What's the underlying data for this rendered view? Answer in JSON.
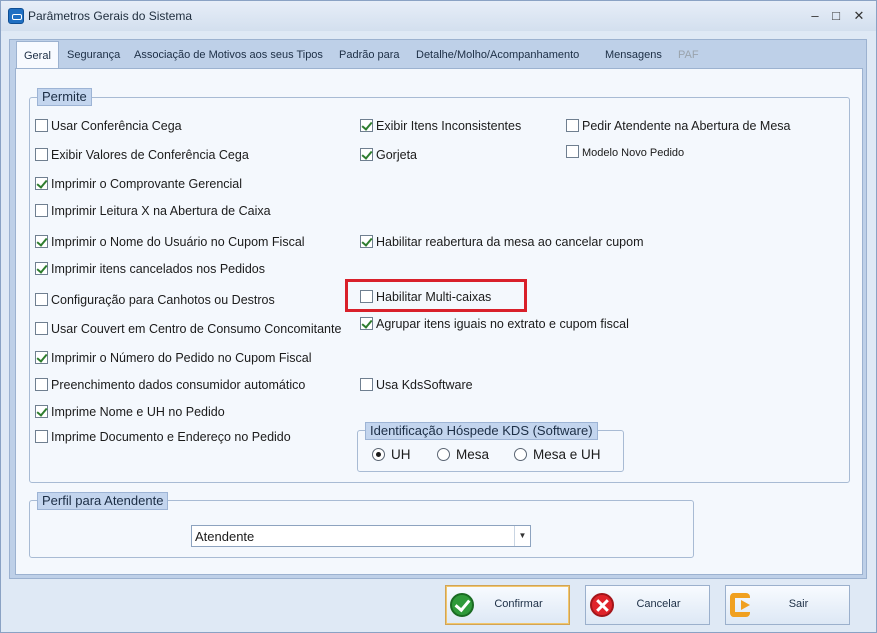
{
  "window": {
    "title": "Parâmetros Gerais do Sistema",
    "controls": {
      "minimize": "–",
      "maximize": "□",
      "close": "✕"
    }
  },
  "tabs": [
    {
      "label": "Geral",
      "active": true
    },
    {
      "label": "Segurança"
    },
    {
      "label": "Associação de Motivos aos seus Tipos"
    },
    {
      "label": "Padrão para"
    },
    {
      "label": "Detalhe/Molho/Acompanhamento"
    },
    {
      "label": "Mensagens"
    },
    {
      "label": "PAF",
      "disabled": true
    }
  ],
  "permite": {
    "legend": "Permite",
    "options": [
      {
        "label": "Usar Conferência Cega",
        "checked": false
      },
      {
        "label": "Exibir Valores de Conferência Cega",
        "checked": false
      },
      {
        "label": "Imprimir o Comprovante Gerencial",
        "checked": true
      },
      {
        "label": "Imprimir Leitura X na Abertura de Caixa",
        "checked": false
      },
      {
        "label": "Imprimir o Nome do Usuário no Cupom Fiscal",
        "checked": true
      },
      {
        "label": "Imprimir itens cancelados nos Pedidos",
        "checked": true
      },
      {
        "label": "Configuração para Canhotos ou Destros",
        "checked": false
      },
      {
        "label": "Usar Couvert em Centro de Consumo Concomitante",
        "checked": false
      },
      {
        "label": "Imprimir o Número do Pedido no Cupom Fiscal",
        "checked": true
      },
      {
        "label": "Preenchimento dados consumidor automático",
        "checked": false
      },
      {
        "label": "Imprime Nome e UH no Pedido",
        "checked": true
      },
      {
        "label": "Imprime Documento e Endereço no Pedido",
        "checked": false
      },
      {
        "label": "Exibir Itens Inconsistentes",
        "checked": true
      },
      {
        "label": "Gorjeta",
        "checked": true
      },
      {
        "label": "Habilitar reabertura da mesa ao cancelar cupom",
        "checked": true
      },
      {
        "label": "Habilitar Multi-caixas",
        "checked": false
      },
      {
        "label": "Agrupar itens iguais no extrato e cupom fiscal",
        "checked": true
      },
      {
        "label": "Usa KdsSoftware",
        "checked": false
      },
      {
        "label": "Pedir Atendente na Abertura de Mesa",
        "checked": false
      },
      {
        "label": "Modelo Novo Pedido",
        "checked": false
      }
    ]
  },
  "kds": {
    "legend": "Identificação Hóspede KDS (Software)",
    "options": [
      {
        "label": "UH",
        "selected": true
      },
      {
        "label": "Mesa",
        "selected": false
      },
      {
        "label": "Mesa e UH",
        "selected": false
      }
    ]
  },
  "perfil": {
    "legend": "Perfil para Atendente",
    "value": "Atendente"
  },
  "buttons": {
    "confirm": "Confirmar",
    "cancel": "Cancelar",
    "exit": "Sair"
  },
  "colors": {
    "highlight": "#d9202a",
    "check": "#2e7d2e",
    "confirm_icon": "#2f9a3a",
    "cancel_icon": "#e0232a",
    "exit_icon": "#f0a020"
  }
}
